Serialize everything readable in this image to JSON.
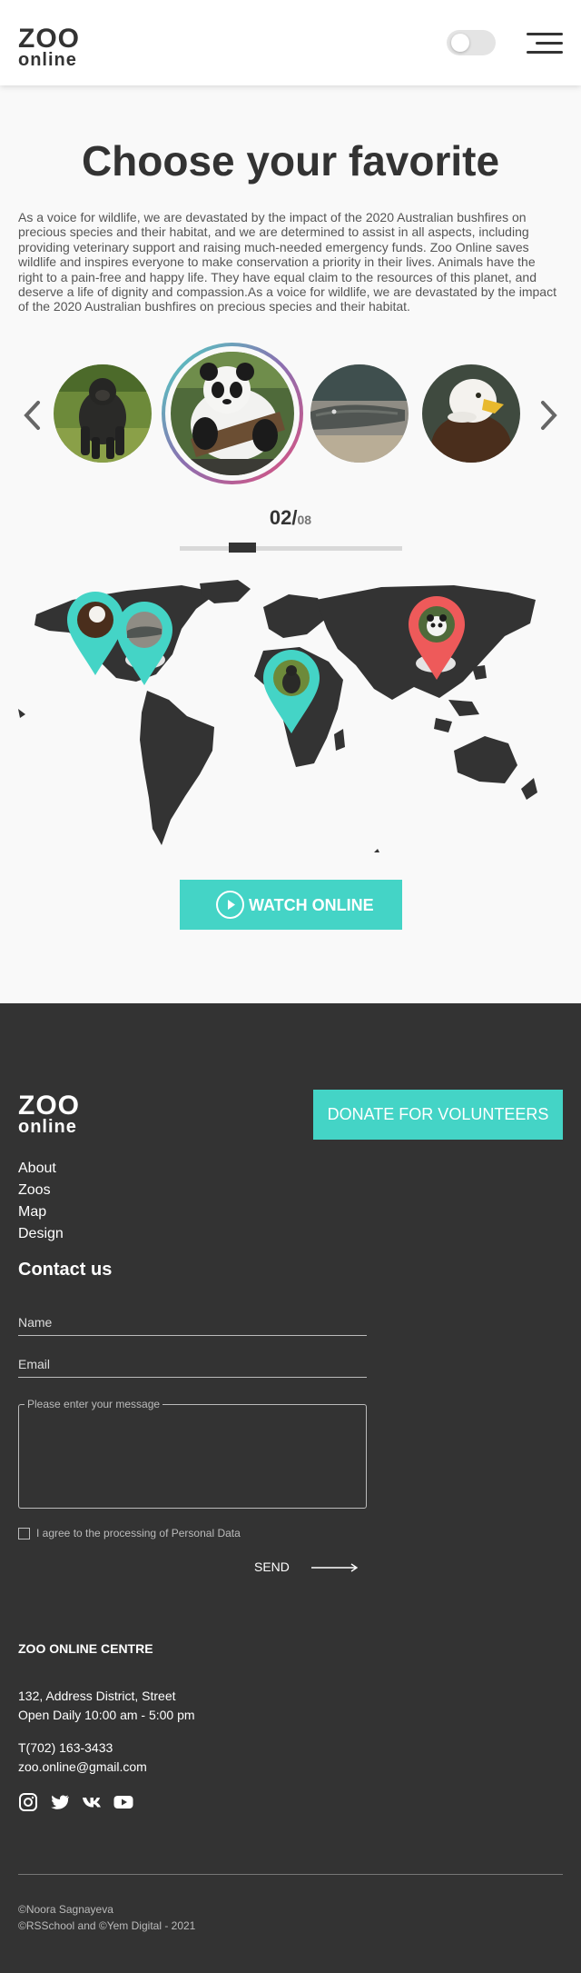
{
  "header": {
    "logo_line1": "ZOO",
    "logo_line2": "online",
    "theme_toggle": "off",
    "menu_icon": "hamburger-icon"
  },
  "hero": {
    "title": "Choose your favorite",
    "description": "As a voice for wildlife, we are devastated by the impact of the 2020 Australian bushfires on precious species and their habitat, and we are determined to assist in all aspects, including providing veterinary support and raising much-needed emergency funds. Zoo Online saves wildlife and inspires everyone to make conservation a priority in their lives. Animals have the right to a pain-free and happy life. They have equal claim to the resources of this planet, and deserve a life of dignity and compassion.As a voice for wildlife, we are devastated by the impact of the 2020 Australian bushfires on precious species and their habitat."
  },
  "carousel": {
    "animals": [
      "gorilla",
      "panda",
      "alligator",
      "eagle"
    ],
    "selected": "panda",
    "current": "02/",
    "total": "08",
    "progress_fraction": 0.25,
    "prev_icon": "chevron-left-icon",
    "next_icon": "chevron-right-icon"
  },
  "map": {
    "pins": [
      {
        "animal": "eagle",
        "color": "#44d4c6"
      },
      {
        "animal": "alligator",
        "color": "#44d4c6"
      },
      {
        "animal": "gorilla",
        "color": "#44d4c6"
      },
      {
        "animal": "panda",
        "color": "#ee5a5a",
        "active": true
      }
    ]
  },
  "watch_button": {
    "label": "WATCH ONLINE",
    "icon": "play-icon"
  },
  "footer": {
    "logo_line1": "ZOO",
    "logo_line2": "online",
    "donate_label": "DONATE FOR VOLUNTEERS",
    "nav": [
      "About",
      "Zoos",
      "Map",
      "Design"
    ],
    "contact_heading": "Contact us",
    "name_placeholder": "Name",
    "email_placeholder": "Email",
    "message_placeholder": "Please enter your message",
    "agree_label": "I agree to the processing of Personal Data",
    "send_label": "SEND",
    "centre_heading": "ZOO ONLINE CENTRE",
    "address": "132, Address District, Street",
    "hours": "Open Daily 10:00 am - 5:00 pm",
    "phone": "T(702) 163-3433",
    "email": "zoo.online@gmail.com",
    "social_icons": [
      "instagram-icon",
      "twitter-icon",
      "vk-icon",
      "youtube-icon"
    ],
    "copyright_1": "©Noora Sagnayeva",
    "copyright_2": "©RSSchool and ©Yem Digital - 2021"
  },
  "colors": {
    "accent": "#44d4c6",
    "pin_active": "#ee5a5a",
    "dark": "#333333",
    "background": "#f9f9f9"
  }
}
